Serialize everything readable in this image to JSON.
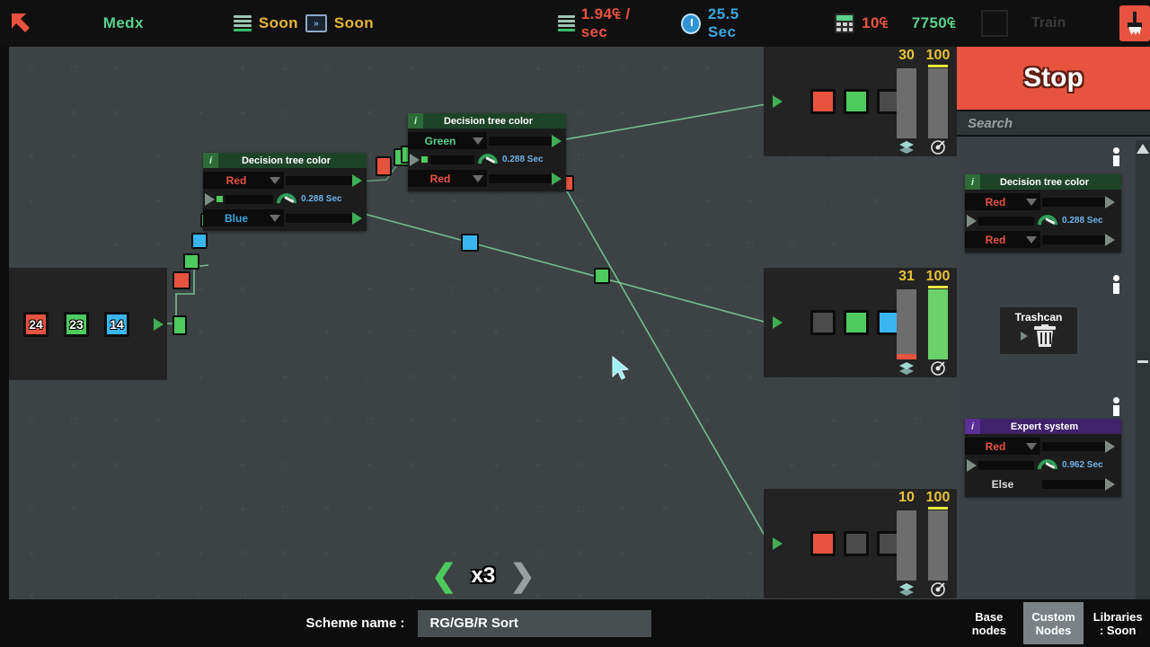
{
  "topbar": {
    "back_icon": "arrow-up-left-icon",
    "title": "Medx",
    "items": [
      {
        "icon": "server-stack-icon",
        "label": "Soon",
        "color": "#e8b43a"
      },
      {
        "icon": "fast-forward-icon",
        "label": "Soon",
        "color": "#e8b43a"
      }
    ],
    "rate": {
      "icon": "server-stack-icon",
      "value": "1.94₠ / sec"
    },
    "timer": {
      "icon": "stopwatch-icon",
      "value": "25.5 Sec"
    },
    "cost": {
      "icon": "calculator-icon",
      "value": "10₠"
    },
    "money": {
      "value": "7750₠"
    },
    "train_label": "Train",
    "clear_icon": "broom-icon"
  },
  "canvas": {
    "grid_marks": [
      "·",
      "×",
      "□",
      "+"
    ],
    "input_panel": {
      "cubes": [
        {
          "value": "24",
          "color": "#e8533f"
        },
        {
          "value": "23",
          "color": "#4ecb5e"
        },
        {
          "value": "14",
          "color": "#39b6f0"
        }
      ],
      "out_port_icon": "play-icon"
    },
    "nodes": [
      {
        "name": "Decision tree color",
        "info": "i",
        "header_color": "#1d4427",
        "rows": [
          {
            "type": "select",
            "value": "Red",
            "color": "#e8533f"
          },
          {
            "type": "gauge",
            "value": "0.288 Sec"
          },
          {
            "type": "select",
            "value": "Blue",
            "color": "#39b6f0"
          }
        ]
      },
      {
        "name": "Decision tree color",
        "info": "i",
        "header_color": "#1d4427",
        "rows": [
          {
            "type": "select",
            "value": "Green",
            "color": "#5bd18d"
          },
          {
            "type": "gauge",
            "value": "0.288 Sec"
          },
          {
            "type": "select",
            "value": "Red",
            "color": "#e8533f"
          }
        ]
      }
    ],
    "bins": [
      {
        "slots": [
          {
            "color": "#e8533f"
          },
          {
            "color": "#4ecb5e"
          },
          {
            "color": "#4b4b4b"
          }
        ],
        "count": "30",
        "count_icon": "layers-icon",
        "target": "100",
        "target_icon": "target-icon",
        "count_fill_pct": 0,
        "count_fill_color": "#e8533f",
        "target_fill_pct": 0,
        "target_fill_color": "#6bd16b"
      },
      {
        "slots": [
          {
            "color": "#4b4b4b"
          },
          {
            "color": "#4ecb5e"
          },
          {
            "color": "#39b6f0"
          }
        ],
        "count": "31",
        "count_icon": "layers-icon",
        "target": "100",
        "target_icon": "target-icon",
        "count_fill_pct": 8,
        "count_fill_color": "#e8533f",
        "target_fill_pct": 100,
        "target_fill_color": "#6bd16b"
      },
      {
        "slots": [
          {
            "color": "#e8533f"
          },
          {
            "color": "#4b4b4b"
          },
          {
            "color": "#4b4b4b"
          }
        ],
        "count": "10",
        "count_icon": "layers-icon",
        "target": "100",
        "target_icon": "target-icon",
        "count_fill_pct": 0,
        "count_fill_color": "#e8533f",
        "target_fill_pct": 0,
        "target_fill_color": "#6bd16b"
      }
    ],
    "speed": {
      "value": "x3",
      "prev_icon": "chevron-left-icon",
      "next_icon": "chevron-right-icon"
    },
    "cursor_icon": "mouse-pointer-icon"
  },
  "sidebar": {
    "stop_label": "Stop",
    "search_placeholder": "Search",
    "items": [
      {
        "kind": "node",
        "name": "Decision tree color",
        "header_color": "#1d4427",
        "info": "i",
        "rows": [
          {
            "type": "select",
            "value": "Red",
            "color": "#e8533f"
          },
          {
            "type": "gauge",
            "value": "0.288 Sec"
          },
          {
            "type": "select",
            "value": "Red",
            "color": "#e8533f"
          }
        ]
      },
      {
        "kind": "trashcan",
        "label": "Trashcan",
        "icon": "trash-icon",
        "info": "i"
      },
      {
        "kind": "node",
        "name": "Expert system",
        "header_color": "#40216b",
        "info": "i",
        "rows": [
          {
            "type": "select",
            "value": "Red",
            "color": "#e8533f"
          },
          {
            "type": "gauge",
            "value": "0.962 Sec"
          },
          {
            "type": "plain",
            "value": "Else",
            "color": "#dddddd"
          }
        ]
      }
    ],
    "scroll_up_icon": "triangle-up-icon",
    "tabs": [
      {
        "line1": "Base",
        "line2": "nodes",
        "active": false
      },
      {
        "line1": "Custom",
        "line2": "Nodes",
        "active": true
      },
      {
        "line1": "Libraries",
        "line2": ": Soon",
        "active": false
      }
    ]
  },
  "bottom": {
    "scheme_label": "Scheme name :",
    "scheme_value": "RG/GB/R Sort"
  }
}
